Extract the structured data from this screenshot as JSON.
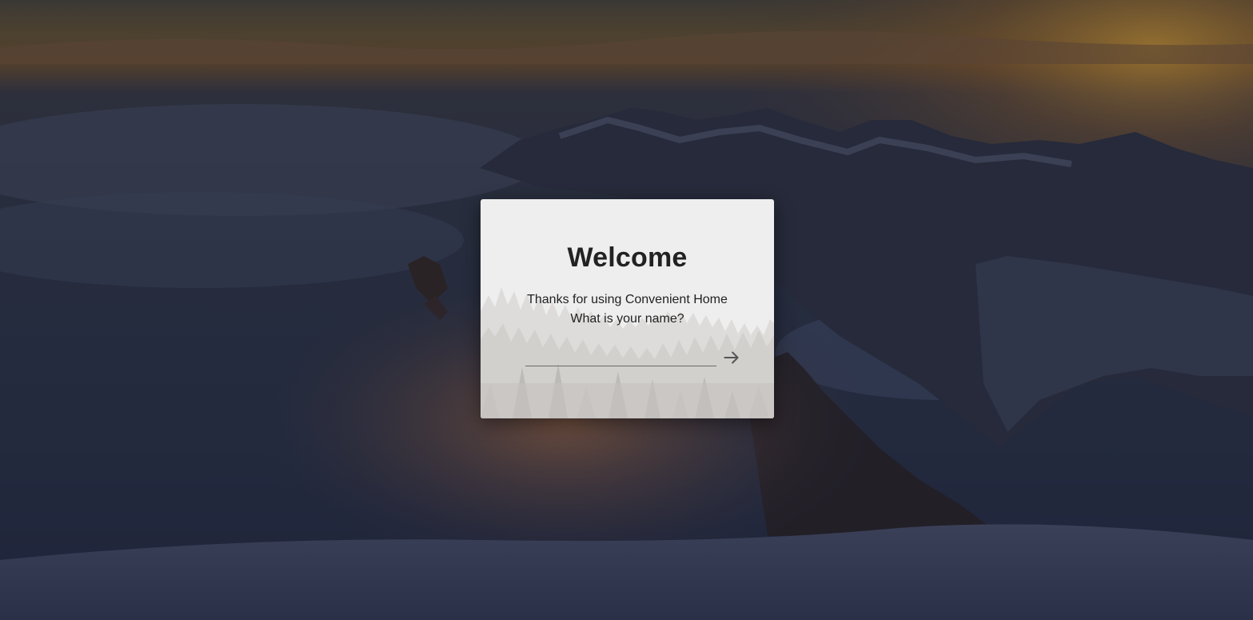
{
  "welcome_dialog": {
    "title": "Welcome",
    "subtitle_line1": "Thanks for using Convenient Home",
    "subtitle_line2": "What is your name?",
    "name_input": {
      "value": "",
      "placeholder": ""
    },
    "submit_icon": "arrow-right-icon"
  },
  "background": {
    "description_icon": "mountain-sunset-background"
  },
  "colors": {
    "dialog_bg": "#eeeeee",
    "text": "#222222",
    "icon": "#555555"
  }
}
